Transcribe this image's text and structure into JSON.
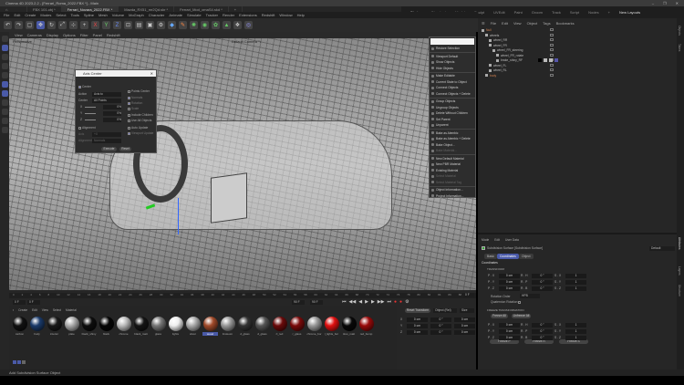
{
  "window": {
    "title": "Cinema 4D 2023.2.2 - [Ferrari_Roma_2022.FBX *] - Main",
    "controls": [
      "–",
      "❐",
      "✕"
    ]
  },
  "doc_tabs": [
    "FBX 101.obj *",
    "Ferrari_Novara_2022.FBX *",
    "Mazda_RX51_mr2Qd.skr *",
    "Ferrari_Mod_omaS4.skd *"
  ],
  "layouts": {
    "items": [
      "Startup",
      "Standard",
      "Model",
      "Sculpt",
      "UVEdit",
      "Paint",
      "Groom",
      "Track",
      "Script",
      "Nodes"
    ],
    "active": "Startup",
    "new_layouts": "New Layouts"
  },
  "menu": [
    "File",
    "Edit",
    "Create",
    "Modes",
    "Select",
    "Tools",
    "Spline",
    "Mesh",
    "Volume",
    "MoGraph",
    "Character",
    "Animate",
    "Simulate",
    "Tracker",
    "Render",
    "Extensions",
    "Redshift",
    "Window",
    "Help"
  ],
  "viewport": {
    "menu": [
      "View",
      "Cameras",
      "Display",
      "Options",
      "Filter",
      "Panel",
      "Redshift"
    ],
    "label": "Perspective",
    "camera": "Default Camera °•"
  },
  "dialog": {
    "title": "Axis Center",
    "center_label": "Center",
    "action_label": "Action",
    "action_value": "Axis to",
    "center2_label": "Center",
    "center2_value": "All Points",
    "x": "X",
    "y": "Y",
    "z": "Z",
    "x_val": "0%",
    "y_val": "0%",
    "z_val": "0%",
    "alignment_label": "Alignment",
    "axis_label": "Axis",
    "axis_value": "+X",
    "alignment2_label": "Alignment",
    "alignment2_value": "Normals",
    "points_center": "Points Center",
    "normals": "Normals",
    "rotation": "Rotation",
    "scale": "Scale",
    "include_children": "Include Children",
    "use_all_objects": "Use All Objects",
    "auto_update": "Auto Update",
    "viewport_update": "Viewport Update",
    "execute": "Execute",
    "reset": "Reset"
  },
  "context_menu": [
    {
      "label": "Restore Selection",
      "enabled": true
    },
    {
      "sep": true
    },
    {
      "label": "Viewport Default",
      "enabled": true
    },
    {
      "label": "Show Objects",
      "enabled": true
    },
    {
      "label": "Hide Objects",
      "enabled": true
    },
    {
      "sep": true
    },
    {
      "label": "Make Editable",
      "enabled": true
    },
    {
      "label": "Current State to Object",
      "enabled": true
    },
    {
      "label": "Connect Objects",
      "enabled": true
    },
    {
      "label": "Connect Objects + Delete",
      "enabled": true
    },
    {
      "sep": true
    },
    {
      "label": "Group Objects",
      "enabled": true
    },
    {
      "label": "Ungroup Objects",
      "enabled": true
    },
    {
      "label": "Delete Without Children",
      "enabled": true
    },
    {
      "label": "Set Parent",
      "enabled": true
    },
    {
      "label": "Unparent",
      "enabled": true
    },
    {
      "sep": true
    },
    {
      "label": "Bake as Alembic",
      "enabled": true
    },
    {
      "label": "Bake as Alembic + Delete",
      "enabled": true
    },
    {
      "label": "Bake Object...",
      "enabled": true
    },
    {
      "label": "Bake Material...",
      "enabled": false
    },
    {
      "sep": true
    },
    {
      "label": "New Default Material",
      "enabled": true
    },
    {
      "label": "New PBR Material",
      "enabled": true
    },
    {
      "label": "Existing Material",
      "enabled": true
    },
    {
      "label": "Select Material",
      "enabled": false
    },
    {
      "label": "Select Material Tag",
      "enabled": false
    },
    {
      "sep": true
    },
    {
      "label": "Object Information...",
      "enabled": true
    },
    {
      "label": "Project Information...",
      "enabled": true
    }
  ],
  "object_manager": {
    "menu": [
      "File",
      "Edit",
      "View",
      "Object",
      "Tags",
      "Bookmarks"
    ],
    "objects": [
      {
        "name": "Null",
        "depth": 0
      },
      {
        "name": "wheels",
        "depth": 1
      },
      {
        "name": "wheel_RR",
        "depth": 2
      },
      {
        "name": "wheel_FR",
        "depth": 2
      },
      {
        "name": "wheel_FR_steering",
        "depth": 3
      },
      {
        "name": "wheel_FR_rotate",
        "depth": 4
      },
      {
        "name": "brake_shiny_RF",
        "depth": 4
      },
      {
        "name": "wheel_FL",
        "depth": 2
      },
      {
        "name": "wheel_RL",
        "depth": 2
      },
      {
        "name": "body",
        "depth": 1
      }
    ]
  },
  "attributes": {
    "menu": [
      "Mode",
      "Edit",
      "User Data"
    ],
    "object": "Subdivision Surface [Subdivision Surface]",
    "preset": "Default",
    "tabs": [
      "Basic",
      "Coordinates",
      "Object"
    ],
    "active_tab": "Coordinates",
    "section": "Coordinates",
    "transform": "TRANSFORM",
    "freeze": "FREEZE TRANSFORMATION",
    "rows": [
      {
        "p": "P . X",
        "pv": "0 cm",
        "r": "R . H",
        "rv": "0 °",
        "s": "S . X",
        "sv": "1"
      },
      {
        "p": "P . Y",
        "pv": "0 cm",
        "r": "R . P",
        "rv": "0 °",
        "s": "S . Y",
        "sv": "1"
      },
      {
        "p": "P . Z",
        "pv": "0 cm",
        "r": "R . B",
        "rv": "0 °",
        "s": "S . Z",
        "sv": "1"
      }
    ],
    "rotation_order_label": "Rotation Order",
    "rotation_order": "HPB",
    "quaternion": "Quaternion Rotation",
    "freeze_all": "Freeze All",
    "unfreeze_all": "Unfreeze All",
    "freeze_p": "Freeze P",
    "freeze_r": "Freeze R",
    "freeze_s": "Freeze S"
  },
  "side_tabs": [
    "Attributes",
    "Layers",
    "Structure"
  ],
  "right_tabs": [
    "Objects",
    "Takes"
  ],
  "timeline": {
    "ticks": [
      "0",
      "2",
      "4",
      "6",
      "8",
      "10",
      "12",
      "14",
      "16",
      "18",
      "20",
      "22",
      "24",
      "26",
      "28",
      "30",
      "32",
      "34",
      "36",
      "38",
      "40",
      "42",
      "44",
      "46",
      "48",
      "50",
      "52",
      "54",
      "56",
      "58",
      "60",
      "62",
      "64",
      "66",
      "68",
      "70",
      "72",
      "74",
      "76",
      "78",
      "80",
      "82",
      "84",
      "86",
      "88",
      "90"
    ],
    "current": "0 F",
    "start": "0 F",
    "end": "90 F",
    "end2": "90 F",
    "frame": "0 F"
  },
  "materials": {
    "menu": [
      "Create",
      "Edit",
      "View",
      "Select",
      "Material"
    ],
    "items": [
      {
        "name": "carbon",
        "color": "#111"
      },
      {
        "name": "body",
        "color": "#1a3a6a"
      },
      {
        "name": "interior",
        "color": "#1a1a1a"
      },
      {
        "name": "plate",
        "color": "#aaa"
      },
      {
        "name": "black_shiny",
        "color": "#0d0d0d"
      },
      {
        "name": "black",
        "color": "#050505"
      },
      {
        "name": "chrome",
        "color": "#bbb"
      },
      {
        "name": "black_matt",
        "color": "#141414"
      },
      {
        "name": "glass",
        "color": "#777"
      },
      {
        "name": "lights",
        "color": "#eee"
      },
      {
        "name": "silver",
        "color": "#aaa"
      },
      {
        "name": "wood",
        "color": "#a04a2a",
        "selected": true
      },
      {
        "name": "linoleum",
        "color": "#999"
      },
      {
        "name": "d_glass",
        "color": "#333"
      },
      {
        "name": "d_glass",
        "color": "#555"
      },
      {
        "name": "rl_red",
        "color": "#6a0a0a"
      },
      {
        "name": "r_glass",
        "color": "#7a0a0a"
      },
      {
        "name": "chrome_bor",
        "color": "#999"
      },
      {
        "name": "l_lights_bor",
        "color": "#e01010"
      },
      {
        "name": "tires_matt",
        "color": "#080808"
      },
      {
        "name": "red_bump",
        "color": "#9a0a0a"
      }
    ]
  },
  "coordinates": {
    "position_label": "Reset Transform",
    "mode": "Object (Rel)",
    "size_mode": "Size",
    "rows": [
      {
        "axis": "X",
        "p": "0 cm",
        "r": "0 °",
        "s": "0 cm"
      },
      {
        "axis": "Y",
        "p": "0 cm",
        "r": "0 °",
        "s": "0 cm"
      },
      {
        "axis": "Z",
        "p": "0 cm",
        "r": "0 °",
        "s": "0 cm"
      }
    ]
  },
  "status": "Add Subdivision Surface Object"
}
